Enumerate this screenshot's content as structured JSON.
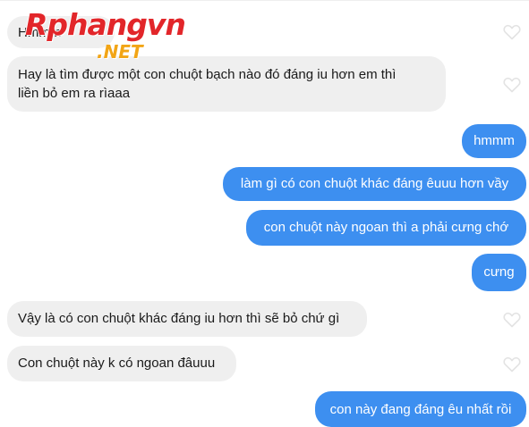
{
  "watermark": {
    "main": "Rphangvn",
    "sub": ".NET"
  },
  "messages": [
    {
      "sender": "other",
      "text": "Hmmm"
    },
    {
      "sender": "other",
      "lines": [
        "Hay là tìm được một con chuột bạch nào đó đáng iu hơn em thì",
        "liền bỏ em ra rìaaa"
      ]
    },
    {
      "sender": "me",
      "text": "hmmm"
    },
    {
      "sender": "me",
      "text": "làm gì có con chuột khác đáng êuuu hơn vầy"
    },
    {
      "sender": "me",
      "text": "con chuột này ngoan thì a phải cưng chớ"
    },
    {
      "sender": "me",
      "text": "cưng"
    },
    {
      "sender": "other",
      "text": "Vậy là có con chuột khác đáng iu hơn thì sẽ bỏ chứ gì"
    },
    {
      "sender": "other",
      "text": "Con chuột này k có ngoan đâuuu"
    },
    {
      "sender": "me",
      "text": "con này đang đáng êu nhất rồi"
    }
  ],
  "colors": {
    "sent_bubble": "#3d8ff0",
    "received_bubble": "#efefef",
    "watermark_main": "#e2262a",
    "watermark_sub": "#f2a516"
  },
  "icons": {
    "like": "heart-outline-icon"
  }
}
